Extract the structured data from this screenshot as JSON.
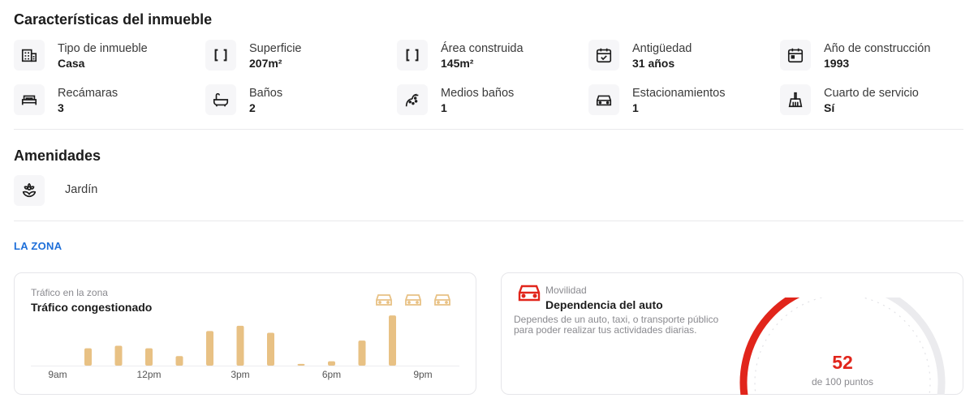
{
  "section_title": "Características del inmueble",
  "features": [
    {
      "icon": "building-icon",
      "label": "Tipo de inmueble",
      "value": "Casa"
    },
    {
      "icon": "area-brackets-icon",
      "label": "Superficie",
      "value": "207m²"
    },
    {
      "icon": "area-brackets-icon",
      "label": "Área construida",
      "value": "145m²"
    },
    {
      "icon": "calendar-check-icon",
      "label": "Antigüedad",
      "value": "31 años"
    },
    {
      "icon": "calendar-icon",
      "label": "Año de construcción",
      "value": "1993"
    },
    {
      "icon": "bed-icon",
      "label": "Recámaras",
      "value": "3"
    },
    {
      "icon": "bathtub-icon",
      "label": "Baños",
      "value": "2"
    },
    {
      "icon": "shower-icon",
      "label": "Medios baños",
      "value": "1"
    },
    {
      "icon": "car-icon",
      "label": "Estacionamientos",
      "value": "1"
    },
    {
      "icon": "broom-icon",
      "label": "Cuarto de servicio",
      "value": "Sí"
    }
  ],
  "amenities_title": "Amenidades",
  "amenities": [
    {
      "icon": "flower-icon",
      "label": "Jardín"
    }
  ],
  "zone_label": "LA ZONA",
  "traffic": {
    "subtitle": "Tráfico en la zona",
    "title": "Tráfico congestionado",
    "car_icons": 3,
    "bar_color": "#e8c184"
  },
  "mobility": {
    "subtitle": "Movilidad",
    "title": "Dependencia del auto",
    "description": "Dependes de un auto, taxi, o transporte público para poder realizar tus actividades diarias.",
    "score": "52",
    "score_unit": "de 100 puntos",
    "accent": "#e1251b"
  },
  "chart_data": {
    "type": "bar",
    "title": "Tráfico congestionado",
    "x_tick_labels": [
      "9am",
      "12pm",
      "3pm",
      "6pm",
      "9pm"
    ],
    "categories": [
      "9am",
      "10am",
      "11am",
      "12pm",
      "1pm",
      "2pm",
      "3pm",
      "4pm",
      "5pm",
      "6pm",
      "7pm",
      "8pm",
      "9pm"
    ],
    "values": [
      0,
      20,
      23,
      20,
      11,
      40,
      46,
      38,
      2,
      5,
      29,
      58,
      0
    ],
    "ylim": [
      0,
      60
    ],
    "grid": false
  }
}
